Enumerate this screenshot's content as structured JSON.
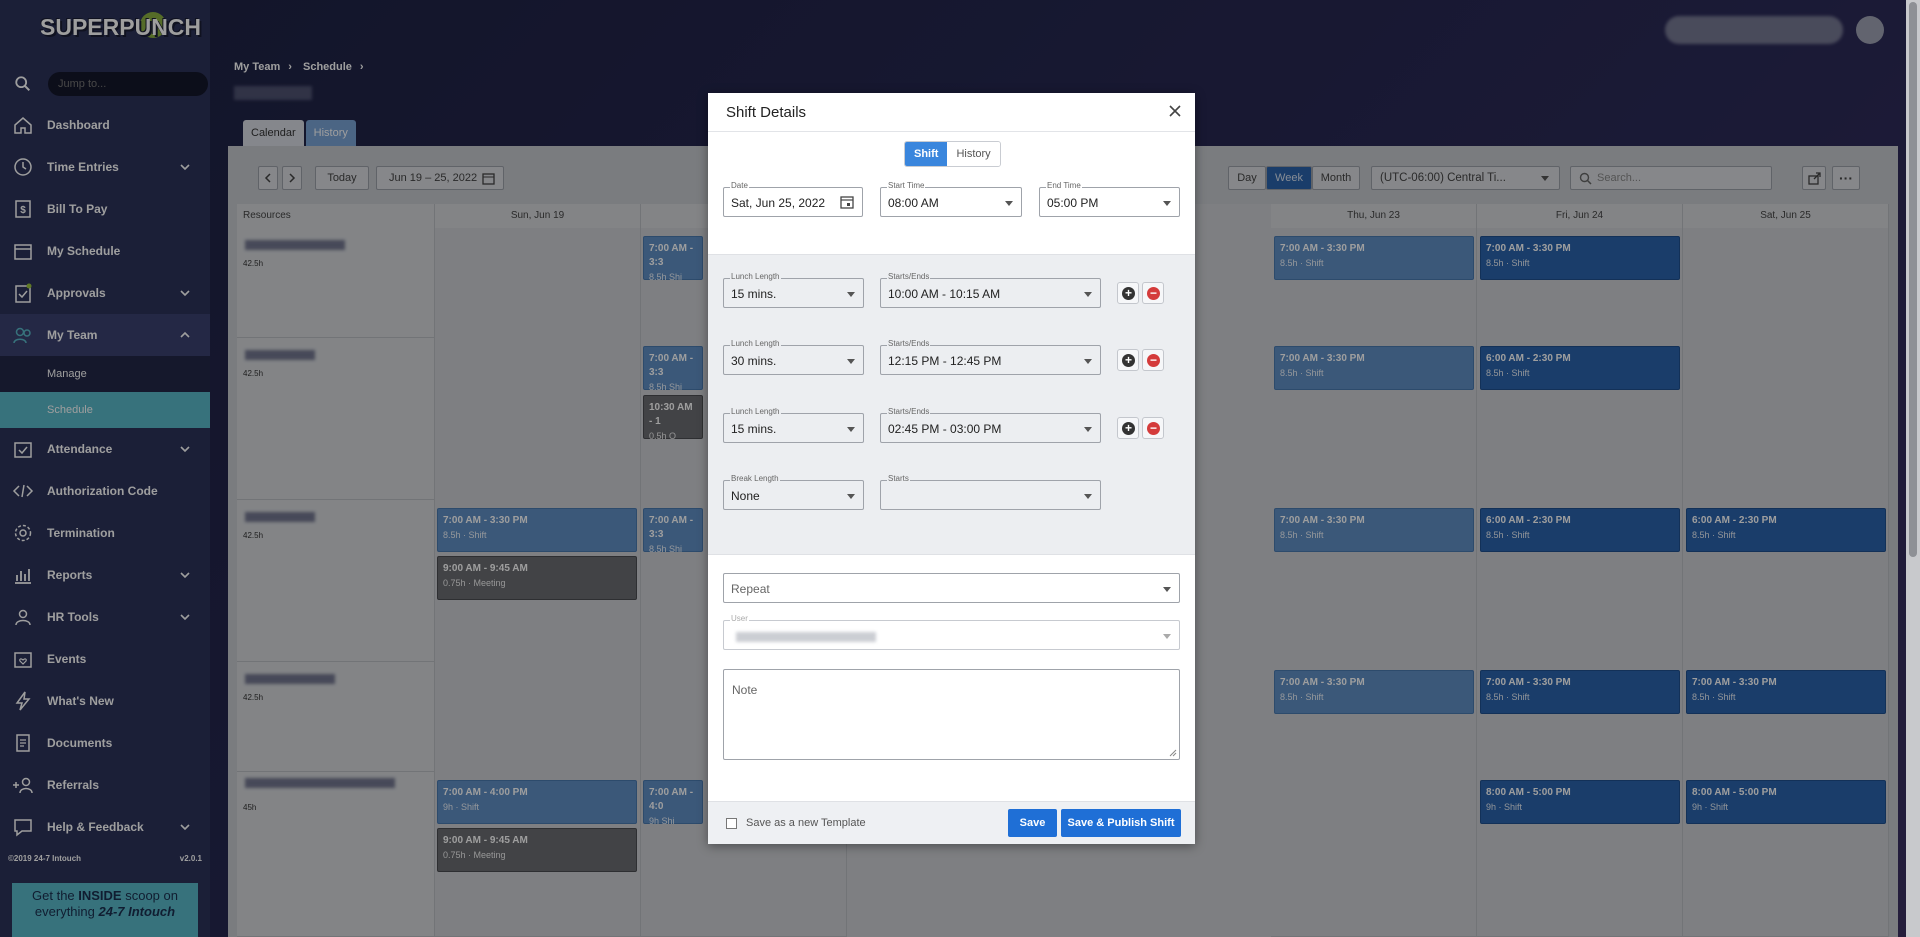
{
  "sidebar": {
    "logo": "SUPERPUNCH",
    "jump_placeholder": "Jump to...",
    "items": [
      {
        "label": "Dashboard"
      },
      {
        "label": "Time Entries"
      },
      {
        "label": "Bill To Pay"
      },
      {
        "label": "My Schedule"
      },
      {
        "label": "Approvals"
      },
      {
        "label": "My Team"
      },
      {
        "label": "Attendance"
      },
      {
        "label": "Authorization Code"
      },
      {
        "label": "Termination"
      },
      {
        "label": "Reports"
      },
      {
        "label": "HR Tools"
      },
      {
        "label": "Events"
      },
      {
        "label": "What's New"
      },
      {
        "label": "Documents"
      },
      {
        "label": "Referrals"
      },
      {
        "label": "Help & Feedback"
      }
    ],
    "sub_items": [
      "Manage",
      "Schedule"
    ],
    "copyright": "©2019 24-7 Intouch",
    "version": "v2.0.1",
    "promo_line1_pre": "Get the ",
    "promo_line1_bold": "INSIDE",
    "promo_line1_post": " scoop on",
    "promo_line2_pre": "everything ",
    "promo_line2_bold": "24-7 Intouch"
  },
  "breadcrumb": {
    "items": [
      "My Team",
      "Schedule"
    ]
  },
  "tabs": {
    "calendar": "Calendar",
    "history": "History"
  },
  "toolbar": {
    "today": "Today",
    "range": "Jun 19 – 25, 2022",
    "day": "Day",
    "week": "Week",
    "month": "Month",
    "timezone": "(UTC-06:00) Central Ti...",
    "search_placeholder": "Search..."
  },
  "grid": {
    "resources_header": "Resources",
    "days": [
      "Sun, Jun 19",
      "Thu, Jun 23",
      "Fri, Jun 24",
      "Sat, Jun 25"
    ],
    "hours": [
      "42.5h",
      "42.5h",
      "42.5h",
      "42.5h",
      "45h"
    ],
    "shift_a": "7:00 AM - 3:30 PM",
    "shift_b": "6:00 AM - 2:30 PM",
    "shift_c": "7:00 AM - 4:00 PM",
    "shift_d": "8:00 AM - 5:00 PM",
    "shift_e": "9:00 AM - 9:45 AM",
    "shift_f": "10:30 AM - 1",
    "shift_g": "7:00 AM - 3:3",
    "shift_h": "7:00 AM - 4:0",
    "dur_85": "8.5h",
    "dur_9": "9h",
    "dur_075": "0.75h",
    "dur_05": "0.5h",
    "kind_shift": "Shift",
    "kind_meeting": "Meeting",
    "kind_sh": "Shi",
    "kind_o": "O"
  },
  "modal": {
    "title": "Shift Details",
    "seg_shift": "Shift",
    "seg_history": "History",
    "date_label": "Date",
    "date_value": "Sat, Jun 25, 2022",
    "start_label": "Start Time",
    "start_value": "08:00 AM",
    "end_label": "End Time",
    "end_value": "05:00 PM",
    "lunch_label": "Lunch Length",
    "starts_ends_label": "Starts/Ends",
    "lunches": [
      {
        "length": "15 mins.",
        "range": "10:00 AM - 10:15 AM"
      },
      {
        "length": "30 mins.",
        "range": "12:15 PM - 12:45 PM"
      },
      {
        "length": "15 mins.",
        "range": "02:45 PM - 03:00 PM"
      }
    ],
    "break_label": "Break Length",
    "break_value": "None",
    "starts_label": "Starts",
    "repeat": "Repeat",
    "user_label": "User",
    "note_placeholder": "Note",
    "save_template": "Save as a new Template",
    "save": "Save",
    "save_publish": "Save & Publish Shift"
  },
  "colors": {
    "sidebar": "#2c3259",
    "accent": "#5ab8c8",
    "primary": "#1f6fd6",
    "danger": "#d43b3b"
  }
}
